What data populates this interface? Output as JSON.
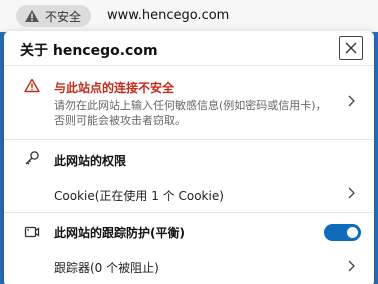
{
  "address_bar": {
    "security_label": "不安全",
    "url": "www.hencego.com"
  },
  "panel": {
    "title": "关于 hencego.com",
    "warning": {
      "title": "与此站点的连接不安全",
      "description_line1": "请勿在此网站上输入任何敏感信息(例如密码或信用卡)，",
      "description_line2": "否则可能会被攻击者窃取。"
    },
    "permissions": {
      "title": "此网站的权限",
      "cookie_label": "Cookie(正在使用 1 个 Cookie)"
    },
    "tracking": {
      "title": "此网站的跟踪防护(平衡)",
      "enabled": true,
      "trackers_label": "跟踪器(0 个被阻止)"
    }
  },
  "colors": {
    "warning_red": "#c42b1c",
    "toggle_blue": "#0f6cbd",
    "backdrop_blue": "#2a6fb8"
  },
  "icons": {
    "security": "warning-triangle-icon",
    "close": "close-icon",
    "warning": "warning-triangle-icon",
    "permissions": "key-icon",
    "tracking": "tracking-prevention-icon",
    "chevron": "chevron-right-icon"
  }
}
